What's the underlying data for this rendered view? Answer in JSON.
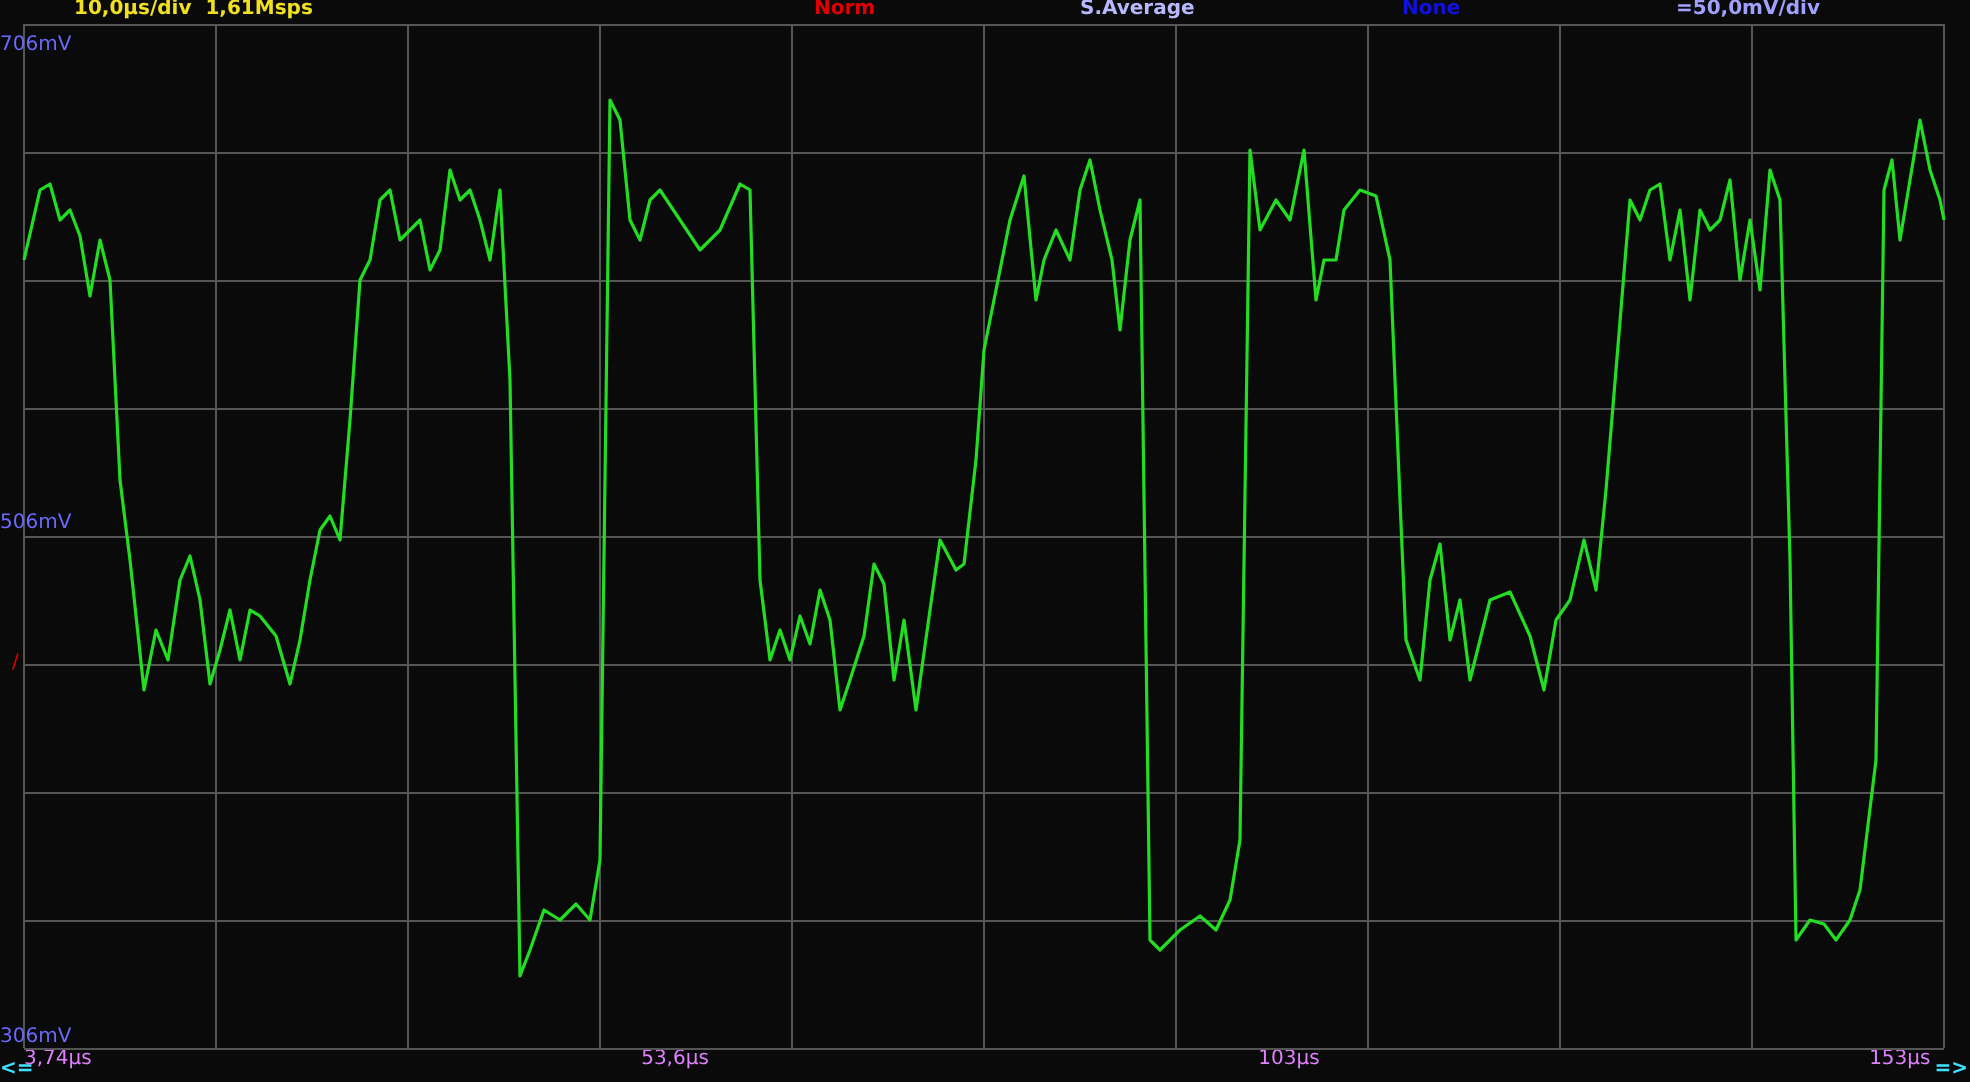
{
  "header": [
    {
      "text": "10,0µs/div  1,61Msps",
      "color": "#f0e020"
    },
    {
      "text": "Norm",
      "color": "#e00000"
    },
    {
      "text": "S.Average",
      "color": "#b8b8ff"
    },
    {
      "text": "None",
      "color": "#1010e0"
    },
    {
      "text": "=50,0mV/div",
      "color": "#a0a0ff"
    }
  ],
  "y_labels": [
    "706mV",
    "506mV",
    "306mV"
  ],
  "trigger_marker": "/",
  "x_labels": [
    "3,74µs",
    "53,6µs",
    "103µs",
    "153µs"
  ],
  "scroll_left": "<=",
  "scroll_right": "=>"
}
